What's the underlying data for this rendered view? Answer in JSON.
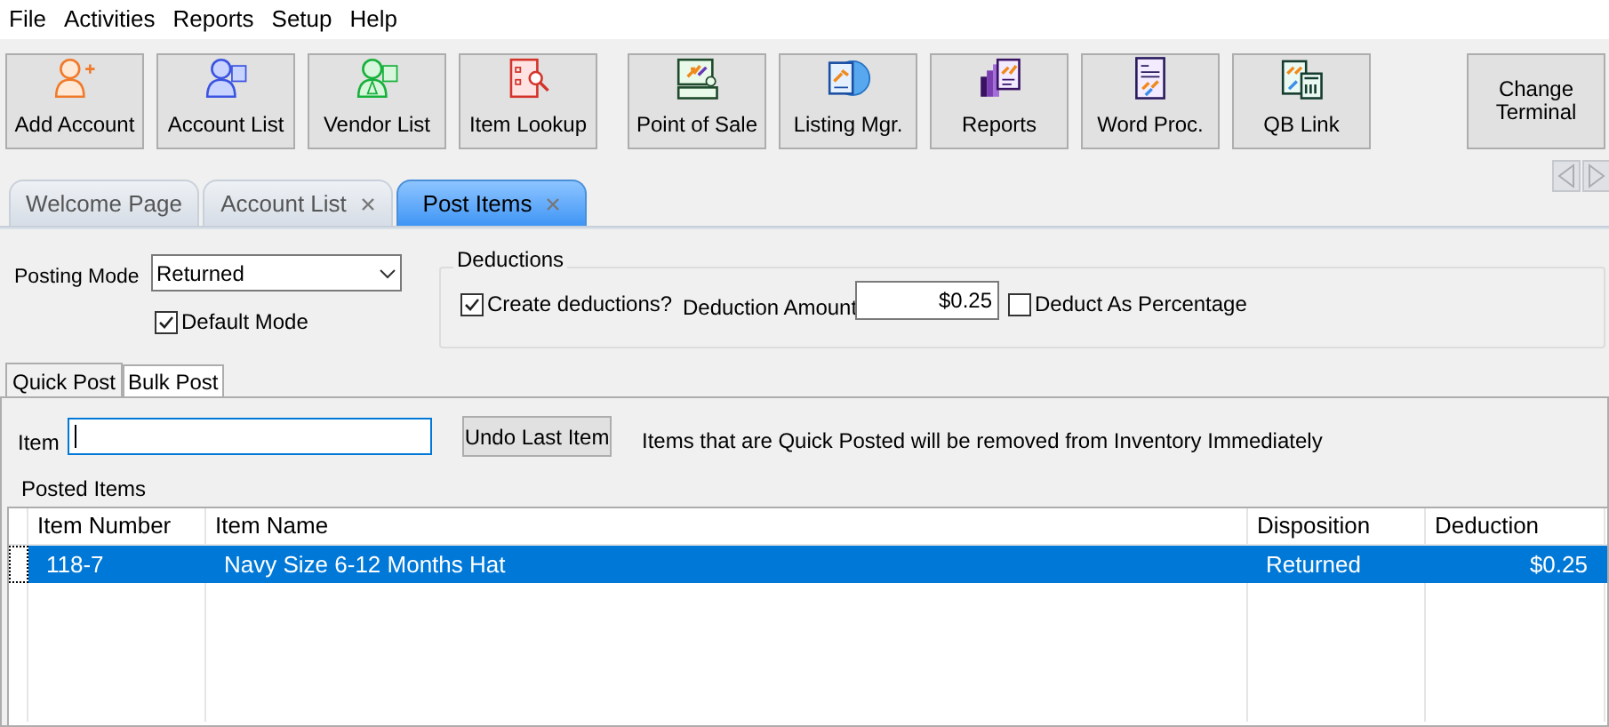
{
  "menu": [
    "File",
    "Activities",
    "Reports",
    "Setup",
    "Help"
  ],
  "toolbar": [
    {
      "label": "Add Account"
    },
    {
      "label": "Account List"
    },
    {
      "label": "Vendor List"
    },
    {
      "label": "Item Lookup"
    },
    {
      "label": "Point of Sale"
    },
    {
      "label": "Listing Mgr."
    },
    {
      "label": "Reports"
    },
    {
      "label": "Word Proc."
    },
    {
      "label": "QB Link"
    }
  ],
  "change_terminal": "Change Terminal",
  "tabs": [
    {
      "label": "Welcome Page",
      "selected": false,
      "closable": false
    },
    {
      "label": "Account List",
      "selected": false,
      "closable": true
    },
    {
      "label": "Post Items",
      "selected": true,
      "closable": true
    }
  ],
  "posting_mode": {
    "label": "Posting Mode",
    "value": "Returned"
  },
  "default_mode": {
    "label": "Default Mode",
    "checked": true
  },
  "deductions": {
    "title": "Deductions",
    "create": {
      "label": "Create deductions?",
      "checked": true
    },
    "amount_label": "Deduction Amount",
    "amount": "$0.25",
    "percentage": {
      "label": "Deduct As Percentage",
      "checked": false
    }
  },
  "subtabs": [
    {
      "label": "Quick Post",
      "selected": true
    },
    {
      "label": "Bulk Post",
      "selected": false
    }
  ],
  "item_label": "Item",
  "undo_button": "Undo Last Item",
  "note": "Items that are Quick Posted will be removed from Inventory Immediately",
  "posted_items": {
    "title": "Posted Items",
    "columns": [
      "Item Number",
      "Item Name",
      "Disposition",
      "Deduction"
    ],
    "rows": [
      {
        "cells": [
          "118-7",
          "Navy Size 6-12 Months Hat",
          "Returned",
          "$0.25"
        ],
        "selected": true
      }
    ]
  }
}
